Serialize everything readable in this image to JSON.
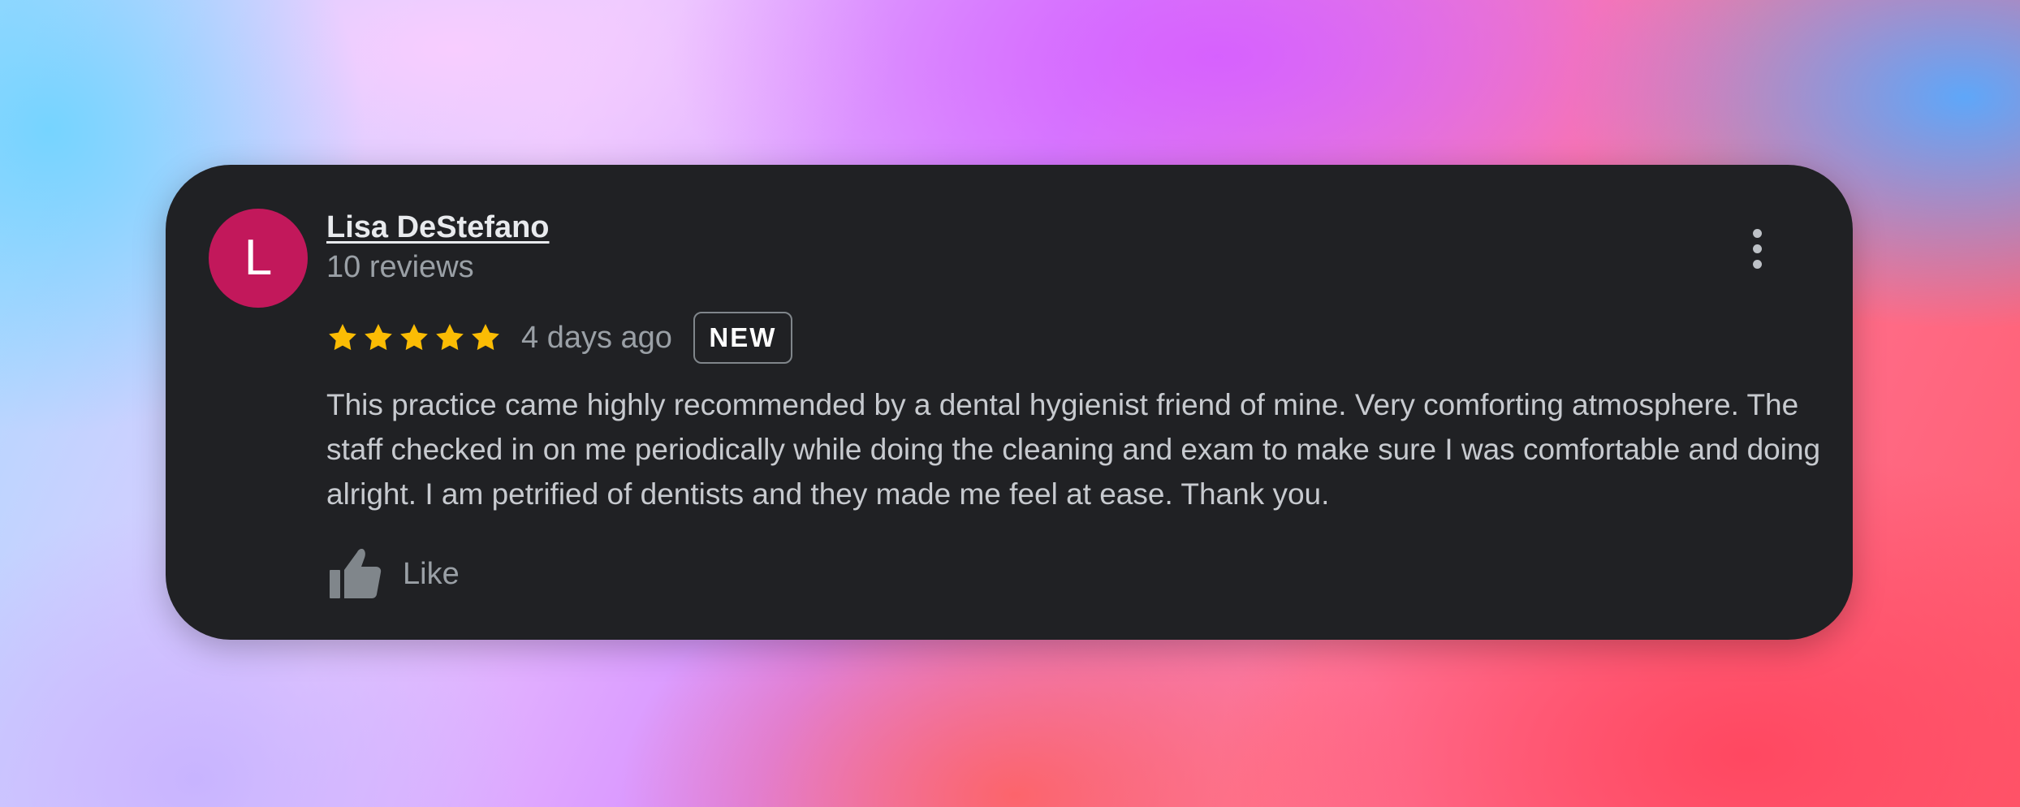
{
  "review": {
    "avatar_letter": "L",
    "avatar_color": "#c2185b",
    "reviewer_name": "Lisa DeStefano",
    "review_count": "10 reviews",
    "rating": 5,
    "max_rating": 5,
    "star_icon": "star-icon",
    "star_color": "#fbbc04",
    "date": "4 days ago",
    "badge": "NEW",
    "text": "This practice came highly recommended by a dental hygienist friend of mine. Very comforting atmosphere. The staff checked in on me periodically while doing the cleaning and exam to make sure I was comfortable and doing alright. I am petrified of dentists and they made me feel at ease. Thank you.",
    "like_label": "Like",
    "like_icon": "thumbs-up-icon",
    "more_icon": "more-vert-icon"
  },
  "colors": {
    "card_background": "#202124",
    "primary_text": "#e8eaed",
    "secondary_text": "#9aa0a6",
    "body_text": "#c7cacf"
  }
}
